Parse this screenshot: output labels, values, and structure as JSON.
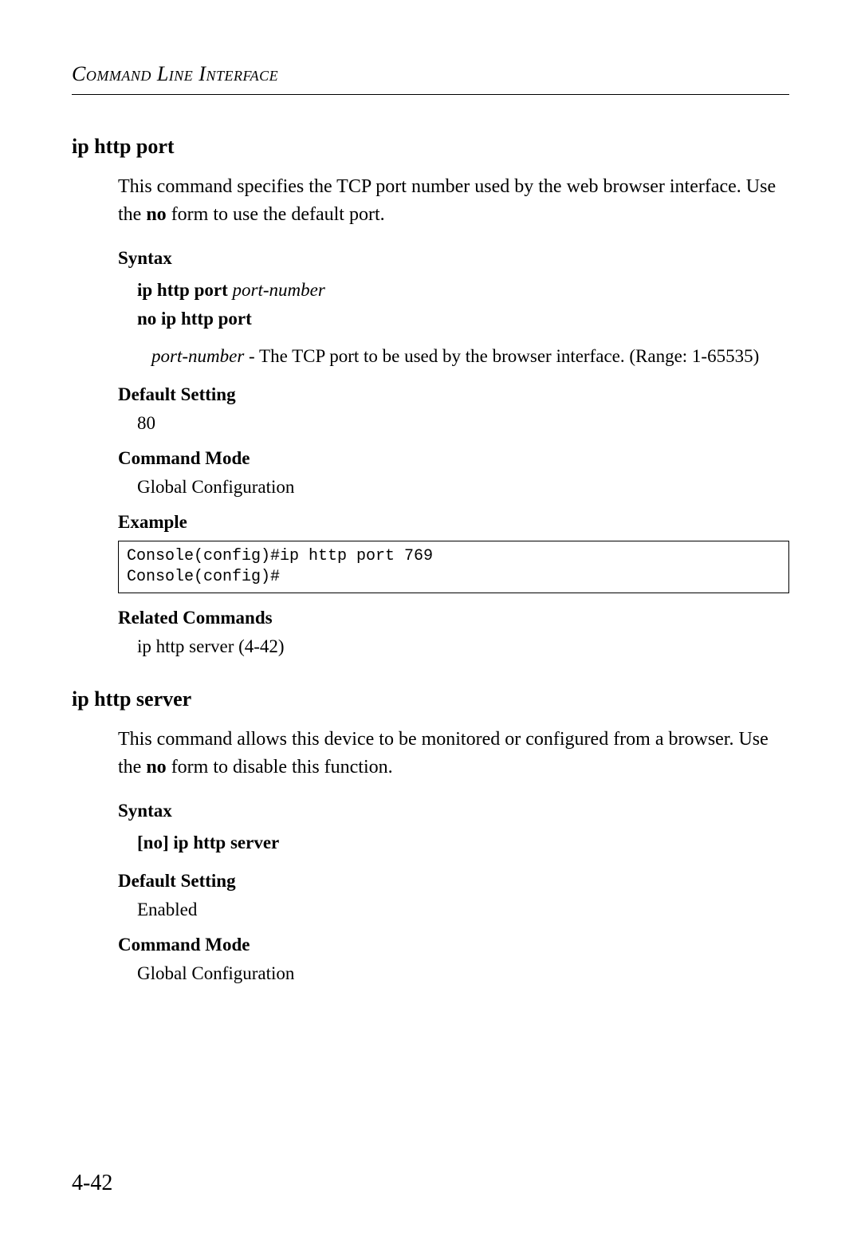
{
  "header": {
    "running_title": "Command Line Interface"
  },
  "section1": {
    "title": "ip http port",
    "description_pre": "This command specifies the TCP port number used by the web browser interface. Use the ",
    "description_bold": "no",
    "description_post": " form to use the default port.",
    "syntax_label": "Syntax",
    "syntax_line1_bold": "ip http port",
    "syntax_line1_italic": " port-number",
    "syntax_line2_bold": "no ip http port",
    "param_name": "port-number",
    "param_desc": " - The TCP port to be used by the browser interface. (Range: 1-65535)",
    "default_label": "Default Setting",
    "default_value": "80",
    "mode_label": "Command Mode",
    "mode_value": "Global Configuration",
    "example_label": "Example",
    "example_code": "Console(config)#ip http port 769\nConsole(config)#",
    "related_label": "Related Commands",
    "related_value": "ip http server (4-42)"
  },
  "section2": {
    "title": "ip http server",
    "description_pre": "This command allows this device to be monitored or configured from a browser. Use the ",
    "description_bold": "no",
    "description_post": " form to disable this function.",
    "syntax_label": "Syntax",
    "syntax_bracket_open": "[",
    "syntax_no": "no",
    "syntax_bracket_close": "] ",
    "syntax_cmd": "ip http server",
    "default_label": "Default Setting",
    "default_value": "Enabled",
    "mode_label": "Command Mode",
    "mode_value": "Global Configuration"
  },
  "page_number": "4-42"
}
